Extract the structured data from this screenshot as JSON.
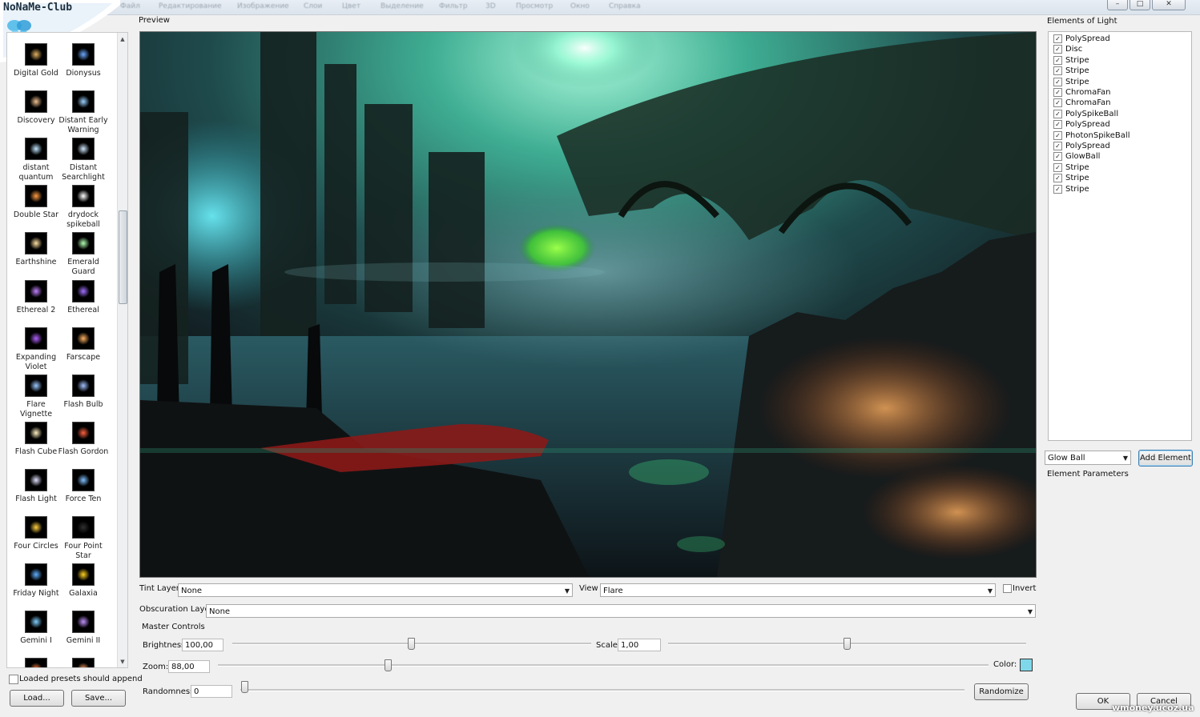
{
  "logo": {
    "text": "NoNaMe-Club"
  },
  "menu": {
    "items": [
      "Файл",
      "Редактирование",
      "Изображение",
      "Слои",
      "Цвет",
      "Выделение",
      "Фильтр",
      "3D",
      "Просмотр",
      "Окно",
      "Справка"
    ]
  },
  "window_controls": {
    "minimize": "–",
    "maximize": "□",
    "close": "✕"
  },
  "presets": {
    "items": [
      {
        "label": "Digital Gold",
        "color": "#e0b060"
      },
      {
        "label": "Dionysus",
        "color": "#6aa8ff"
      },
      {
        "label": "Discovery",
        "color": "#f0c090"
      },
      {
        "label": "Distant Early Warning",
        "color": "#9ad0ff"
      },
      {
        "label": "distant quantum",
        "color": "#bfe6ff"
      },
      {
        "label": "Distant Searchlight",
        "color": "#d0e8ff"
      },
      {
        "label": "Double Star",
        "color": "#ff9a40"
      },
      {
        "label": "drydock spikeball",
        "color": "#ffffff"
      },
      {
        "label": "Earthshine",
        "color": "#ffe0a0"
      },
      {
        "label": "Emerald Guard",
        "color": "#b0ffb0"
      },
      {
        "label": "Ethereal 2",
        "color": "#c080ff"
      },
      {
        "label": "Ethereal",
        "color": "#a070ff"
      },
      {
        "label": "Expanding Violet",
        "color": "#b060ff"
      },
      {
        "label": "Farscape",
        "color": "#ffb060"
      },
      {
        "label": "Flare Vignette",
        "color": "#9ac8ff"
      },
      {
        "label": "Flash Bulb",
        "color": "#a0c0ff"
      },
      {
        "label": "Flash Cube",
        "color": "#fff0c0"
      },
      {
        "label": "Flash Gordon",
        "color": "#ff6040"
      },
      {
        "label": "Flash Light",
        "color": "#e0e0ff"
      },
      {
        "label": "Force Ten",
        "color": "#80c0ff"
      },
      {
        "label": "Four Circles",
        "color": "#ffd040"
      },
      {
        "label": "Four Point Star",
        "color": "#303030"
      },
      {
        "label": "Friday Night",
        "color": "#60b0ff"
      },
      {
        "label": "Galaxia",
        "color": "#ffd020"
      },
      {
        "label": "Gemini I",
        "color": "#80d0ff"
      },
      {
        "label": "Gemini II",
        "color": "#c090ff"
      },
      {
        "label": "",
        "color": "#ff8040"
      },
      {
        "label": "",
        "color": "#ffa060"
      }
    ],
    "append_label": "Loaded presets should append",
    "load_label": "Load...",
    "save_label": "Save..."
  },
  "preview": {
    "label": "Preview"
  },
  "controls": {
    "tint_layer_label": "Tint Layer",
    "tint_layer_value": "None",
    "view_label": "View",
    "view_value": "Flare",
    "invert_label": "Invert",
    "obscuration_label": "Obscuration Layer",
    "obscuration_value": "None",
    "master_label": "Master Controls",
    "brightness_label": "Brightness:",
    "brightness_value": "100,00",
    "scale_label": "Scale:",
    "scale_value": "1,00",
    "zoom_label": "Zoom:",
    "zoom_value": "88,00",
    "color_label": "Color:",
    "color_value": "#7fd8ea",
    "randomness_label": "Randomness:",
    "randomness_value": "0",
    "randomize_label": "Randomize"
  },
  "elements": {
    "header": "Elements of Light",
    "items": [
      "PolySpread",
      "Disc",
      "Stripe",
      "Stripe",
      "Stripe",
      "ChromaFan",
      "ChromaFan",
      "PolySpikeBall",
      "PolySpread",
      "PhotonSpikeBall",
      "PolySpread",
      "GlowBall",
      "Stripe",
      "Stripe",
      "Stripe"
    ],
    "add_type_value": "Glow Ball",
    "add_button": "Add Element",
    "params_header": "Element Parameters"
  },
  "dialog": {
    "ok_label": "OK",
    "cancel_label": "Cancel"
  },
  "watermark": {
    "text": "wmoney.ucoz.ua"
  }
}
